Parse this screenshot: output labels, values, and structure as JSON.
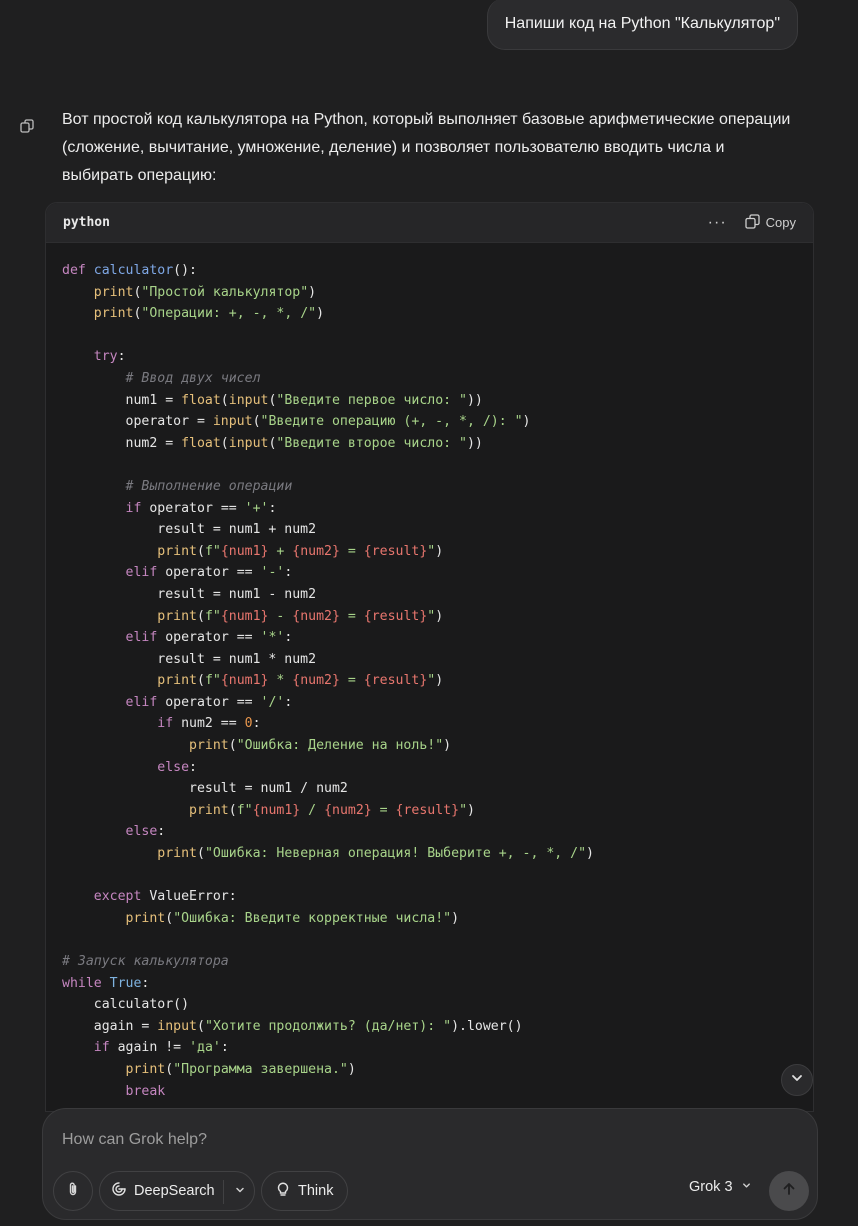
{
  "user_message": "Напиши код на Python \"Калькулятор\"",
  "assistant": {
    "intro": "Вот простой код калькулятора на Python, который выполняет базовые арифметические операции (сложение, вычитание, умножение, деление) и позволяет пользователю вводить числа и выбирать операцию:"
  },
  "code_block": {
    "language": "python",
    "more_label": "···",
    "copy_label": "Copy",
    "lines": [
      [
        [
          "kw",
          "def "
        ],
        [
          "fn",
          "calculator"
        ],
        [
          "",
          "():"
        ]
      ],
      [
        [
          "",
          "    "
        ],
        [
          "bi",
          "print"
        ],
        [
          "",
          "("
        ],
        [
          "str",
          "\"Простой калькулятор\""
        ],
        [
          "",
          ")"
        ]
      ],
      [
        [
          "",
          "    "
        ],
        [
          "bi",
          "print"
        ],
        [
          "",
          "("
        ],
        [
          "str",
          "\"Операции: +, -, *, /\""
        ],
        [
          "",
          ")"
        ]
      ],
      [],
      [
        [
          "",
          "    "
        ],
        [
          "kw",
          "try"
        ],
        [
          "",
          ":"
        ]
      ],
      [
        [
          "",
          "        "
        ],
        [
          "cm",
          "# Ввод двух чисел"
        ]
      ],
      [
        [
          "",
          "        num1 = "
        ],
        [
          "bi",
          "float"
        ],
        [
          "",
          "("
        ],
        [
          "bi",
          "input"
        ],
        [
          "",
          "("
        ],
        [
          "str",
          "\"Введите первое число: \""
        ],
        [
          "",
          "))"
        ]
      ],
      [
        [
          "",
          "        operator = "
        ],
        [
          "bi",
          "input"
        ],
        [
          "",
          "("
        ],
        [
          "str",
          "\"Введите операцию (+, -, *, /): \""
        ],
        [
          "",
          ")"
        ]
      ],
      [
        [
          "",
          "        num2 = "
        ],
        [
          "bi",
          "float"
        ],
        [
          "",
          "("
        ],
        [
          "bi",
          "input"
        ],
        [
          "",
          "("
        ],
        [
          "str",
          "\"Введите второе число: \""
        ],
        [
          "",
          "))"
        ]
      ],
      [],
      [
        [
          "",
          "        "
        ],
        [
          "cm",
          "# Выполнение операции"
        ]
      ],
      [
        [
          "",
          "        "
        ],
        [
          "kw",
          "if"
        ],
        [
          "",
          " operator == "
        ],
        [
          "str",
          "'+'"
        ],
        [
          "",
          ":"
        ]
      ],
      [
        [
          "",
          "            result = num1 + num2"
        ]
      ],
      [
        [
          "",
          "            "
        ],
        [
          "bi",
          "print"
        ],
        [
          "",
          "("
        ],
        [
          "str",
          "f\""
        ],
        [
          "interp",
          "{num1}"
        ],
        [
          "str",
          " + "
        ],
        [
          "interp",
          "{num2}"
        ],
        [
          "str",
          " = "
        ],
        [
          "interp",
          "{result}"
        ],
        [
          "str",
          "\""
        ],
        [
          "",
          ")"
        ]
      ],
      [
        [
          "",
          "        "
        ],
        [
          "kw",
          "elif"
        ],
        [
          "",
          " operator == "
        ],
        [
          "str",
          "'-'"
        ],
        [
          "",
          ":"
        ]
      ],
      [
        [
          "",
          "            result = num1 - num2"
        ]
      ],
      [
        [
          "",
          "            "
        ],
        [
          "bi",
          "print"
        ],
        [
          "",
          "("
        ],
        [
          "str",
          "f\""
        ],
        [
          "interp",
          "{num1}"
        ],
        [
          "str",
          " - "
        ],
        [
          "interp",
          "{num2}"
        ],
        [
          "str",
          " = "
        ],
        [
          "interp",
          "{result}"
        ],
        [
          "str",
          "\""
        ],
        [
          "",
          ")"
        ]
      ],
      [
        [
          "",
          "        "
        ],
        [
          "kw",
          "elif"
        ],
        [
          "",
          " operator == "
        ],
        [
          "str",
          "'*'"
        ],
        [
          "",
          ":"
        ]
      ],
      [
        [
          "",
          "            result = num1 * num2"
        ]
      ],
      [
        [
          "",
          "            "
        ],
        [
          "bi",
          "print"
        ],
        [
          "",
          "("
        ],
        [
          "str",
          "f\""
        ],
        [
          "interp",
          "{num1}"
        ],
        [
          "str",
          " * "
        ],
        [
          "interp",
          "{num2}"
        ],
        [
          "str",
          " = "
        ],
        [
          "interp",
          "{result}"
        ],
        [
          "str",
          "\""
        ],
        [
          "",
          ")"
        ]
      ],
      [
        [
          "",
          "        "
        ],
        [
          "kw",
          "elif"
        ],
        [
          "",
          " operator == "
        ],
        [
          "str",
          "'/'"
        ],
        [
          "",
          ":"
        ]
      ],
      [
        [
          "",
          "            "
        ],
        [
          "kw",
          "if"
        ],
        [
          "",
          " num2 == "
        ],
        [
          "num",
          "0"
        ],
        [
          "",
          ":"
        ]
      ],
      [
        [
          "",
          "                "
        ],
        [
          "bi",
          "print"
        ],
        [
          "",
          "("
        ],
        [
          "str",
          "\"Ошибка: Деление на ноль!\""
        ],
        [
          "",
          ")"
        ]
      ],
      [
        [
          "",
          "            "
        ],
        [
          "kw",
          "else"
        ],
        [
          "",
          ":"
        ]
      ],
      [
        [
          "",
          "                result = num1 / num2"
        ]
      ],
      [
        [
          "",
          "                "
        ],
        [
          "bi",
          "print"
        ],
        [
          "",
          "("
        ],
        [
          "str",
          "f\""
        ],
        [
          "interp",
          "{num1}"
        ],
        [
          "str",
          " / "
        ],
        [
          "interp",
          "{num2}"
        ],
        [
          "str",
          " = "
        ],
        [
          "interp",
          "{result}"
        ],
        [
          "str",
          "\""
        ],
        [
          "",
          ")"
        ]
      ],
      [
        [
          "",
          "        "
        ],
        [
          "kw",
          "else"
        ],
        [
          "",
          ":"
        ]
      ],
      [
        [
          "",
          "            "
        ],
        [
          "bi",
          "print"
        ],
        [
          "",
          "("
        ],
        [
          "str",
          "\"Ошибка: Неверная операция! Выберите +, -, *, /\""
        ],
        [
          "",
          ")"
        ]
      ],
      [],
      [
        [
          "",
          "    "
        ],
        [
          "kw",
          "except"
        ],
        [
          "",
          " ValueError:"
        ]
      ],
      [
        [
          "",
          "        "
        ],
        [
          "bi",
          "print"
        ],
        [
          "",
          "("
        ],
        [
          "str",
          "\"Ошибка: Введите корректные числа!\""
        ],
        [
          "",
          ")"
        ]
      ],
      [],
      [
        [
          "cm",
          "# Запуск калькулятора"
        ]
      ],
      [
        [
          "kw",
          "while"
        ],
        [
          "",
          " "
        ],
        [
          "cls",
          "True"
        ],
        [
          "",
          ":"
        ]
      ],
      [
        [
          "",
          "    calculator()"
        ]
      ],
      [
        [
          "",
          "    again = "
        ],
        [
          "bi",
          "input"
        ],
        [
          "",
          "("
        ],
        [
          "str",
          "\"Хотите продолжить? (да/нет): \""
        ],
        [
          "",
          ").lower()"
        ]
      ],
      [
        [
          "",
          "    "
        ],
        [
          "kw",
          "if"
        ],
        [
          "",
          " again != "
        ],
        [
          "str",
          "'да'"
        ],
        [
          "",
          ":"
        ]
      ],
      [
        [
          "",
          "        "
        ],
        [
          "bi",
          "print"
        ],
        [
          "",
          "("
        ],
        [
          "str",
          "\"Программа завершена.\""
        ],
        [
          "",
          ")"
        ]
      ],
      [
        [
          "",
          "        "
        ],
        [
          "kw",
          "break"
        ]
      ]
    ]
  },
  "composer": {
    "placeholder": "How can Grok help?",
    "deepsearch_label": "DeepSearch",
    "think_label": "Think",
    "model_label": "Grok 3"
  },
  "icons": {
    "copy_message": "copy-icon",
    "code_copy": "copy-icon",
    "scroll_down": "chevron-down-icon",
    "attach": "paperclip-icon",
    "deepsearch": "deepsearch-icon",
    "think": "lightbulb-icon",
    "send": "arrow-up-icon"
  }
}
